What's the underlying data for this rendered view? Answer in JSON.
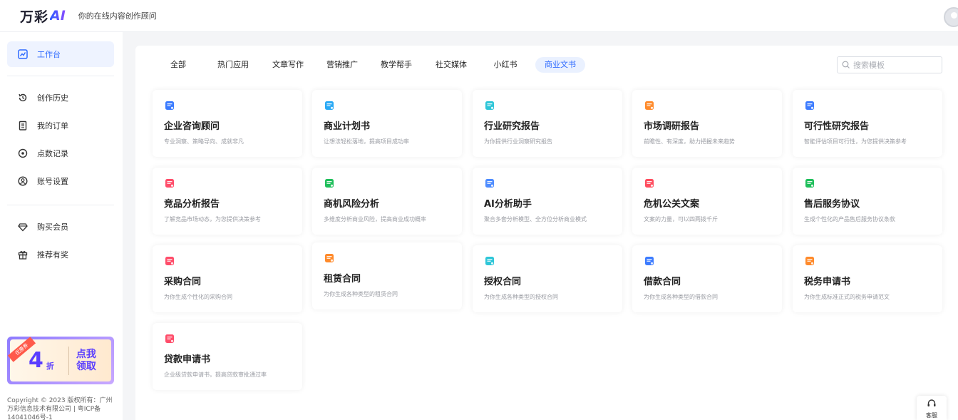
{
  "header": {
    "logo_text": "万彩",
    "logo_ai": "AI",
    "tagline": "你的在线内容创作顾问"
  },
  "sidebar": {
    "items": [
      {
        "label": "工作台",
        "icon": "chart-icon",
        "active": true
      },
      {
        "label": "创作历史",
        "icon": "history-icon"
      },
      {
        "label": "我的订单",
        "icon": "order-icon"
      },
      {
        "label": "点数记录",
        "icon": "points-icon"
      },
      {
        "label": "账号设置",
        "icon": "user-icon"
      },
      {
        "label": "购买会员",
        "icon": "diamond-icon"
      },
      {
        "label": "推荐有奖",
        "icon": "gift-icon"
      }
    ],
    "promo": {
      "ribbon": "优惠券",
      "discount": "4",
      "unit": "折",
      "cta": "点我领取"
    },
    "copyright": "Copyright © 2023 版权所有：广州万彩信息技术有限公司 | 粤ICP备14041046号-1"
  },
  "tabs": [
    {
      "label": "全部"
    },
    {
      "label": "热门应用"
    },
    {
      "label": "文章写作"
    },
    {
      "label": "营销推广"
    },
    {
      "label": "教学帮手"
    },
    {
      "label": "社交媒体"
    },
    {
      "label": "小红书"
    },
    {
      "label": "商业文书",
      "active": true
    }
  ],
  "search": {
    "placeholder": "搜索模板"
  },
  "cards": [
    {
      "title": "企业咨询顾问",
      "desc": "专业洞察、策略导向、成就非凡",
      "color": "#3a7bff",
      "icon": "consult-icon"
    },
    {
      "title": "商业计划书",
      "desc": "让想法轻松落地，提高项目成功率",
      "color": "#29a9f5",
      "icon": "plan-icon"
    },
    {
      "title": "行业研究报告",
      "desc": "为你提供行业洞察研究报告",
      "color": "#2ec6d8",
      "icon": "report-icon"
    },
    {
      "title": "市场调研报告",
      "desc": "前瞻性、有深度，助力把握未来趋势",
      "color": "#ff8a2b",
      "icon": "survey-icon"
    },
    {
      "title": "可行性研究报告",
      "desc": "智能评估项目可行性，为您提供决策参考",
      "color": "#3d7cff",
      "icon": "feasibility-icon"
    },
    {
      "title": "竞品分析报告",
      "desc": "了解竞品市场动态，为您提供决策参考",
      "color": "#ff4d6a",
      "icon": "vs-icon"
    },
    {
      "title": "商机风险分析",
      "desc": "多维度分析商业风险，提高商业成功概率",
      "color": "#1fbf5b",
      "icon": "shield-icon"
    },
    {
      "title": "AI分析助手",
      "desc": "聚合多套分析模型、全方位分析商业模式",
      "color": "#4e8cff",
      "icon": "ai-icon"
    },
    {
      "title": "危机公关文案",
      "desc": "文案的力量，可以四两拨千斤",
      "color": "#ff4d5f",
      "icon": "warning-icon"
    },
    {
      "title": "售后服务协议",
      "desc": "生成个性化的产品售后服务协议条款",
      "color": "#1fbf5b",
      "icon": "service-doc-icon"
    },
    {
      "title": "采购合同",
      "desc": "为你生成个性化的采购合同",
      "color": "#ff4d6a",
      "icon": "contract-icon"
    },
    {
      "title": "租赁合同",
      "desc": "为你生成各种类型的租赁合同",
      "color": "#ff8a2b",
      "icon": "lease-icon"
    },
    {
      "title": "授权合同",
      "desc": "为你生成各种类型的授权合同",
      "color": "#2ec6d8",
      "icon": "license-icon"
    },
    {
      "title": "借款合同",
      "desc": "为你生成各种类型的借款合同",
      "color": "#3d7cff",
      "icon": "loan-icon"
    },
    {
      "title": "税务申请书",
      "desc": "为你生成标准正式的税务申请范文",
      "color": "#ff8a2b",
      "icon": "tax-icon"
    },
    {
      "title": "贷款申请书",
      "desc": "企业级贷款申请书，提高贷款审批通过率",
      "color": "#ff4d6a",
      "icon": "application-icon"
    }
  ],
  "service": {
    "label": "客服"
  }
}
